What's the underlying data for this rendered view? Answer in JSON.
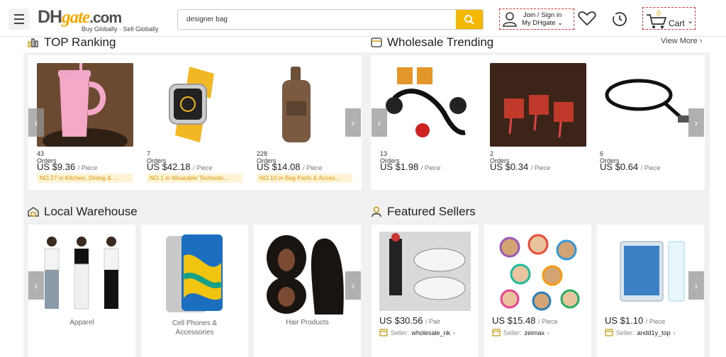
{
  "header": {
    "logo_dh": "DH",
    "logo_gate": "gate",
    "logo_com": ".com",
    "tagline": "Buy Globally · Sell Globally",
    "search_value": "designer bag",
    "account_line1": "Join / Sign in",
    "account_line2": "My DHgate",
    "cart_count": "0",
    "cart_label": "Cart"
  },
  "top_ranking": {
    "title": "TOP Ranking",
    "items": [
      {
        "orders": "43 Orders",
        "price": "US $9.36",
        "unit": "/ Piece",
        "rank": "NO.27 in Kitchen, Dining & ..."
      },
      {
        "orders": "7 Orders",
        "price": "US $42.18",
        "unit": "/ Piece",
        "rank": "NO.1 in Wearable Technolo..."
      },
      {
        "orders": "228 Orders",
        "price": "US $14.08",
        "unit": "/ Piece",
        "rank": "NO.10 in Bag Parts & Acces..."
      }
    ]
  },
  "wholesale_trending": {
    "title": "Wholesale Trending",
    "view_more": "View More",
    "items": [
      {
        "orders": "13 Orders",
        "price": "US $1.98",
        "unit": "/ Piece"
      },
      {
        "orders": "2 Orders",
        "price": "US $0.34",
        "unit": "/ Piece"
      },
      {
        "orders": "6 Orders",
        "price": "US $0.64",
        "unit": "/ Piece"
      }
    ]
  },
  "local_warehouse": {
    "title": "Local Warehouse",
    "categories": [
      {
        "label": "Apparel"
      },
      {
        "label": "Cell Phones &\nAccessories"
      },
      {
        "label": "Hair Products"
      }
    ]
  },
  "featured_sellers": {
    "title": "Featured Sellers",
    "items": [
      {
        "price": "US $30.56",
        "unit": "/ Pair",
        "seller_prefix": "Seller:",
        "seller": "wholesale_nk"
      },
      {
        "price": "US $15.48",
        "unit": "/ Piece",
        "seller_prefix": "Seller:",
        "seller": "zeimax"
      },
      {
        "price": "US $1.10",
        "unit": "/ Piece",
        "seller_prefix": "Seller:",
        "seller": "andd1y_top"
      }
    ]
  },
  "icons": [
    "menu-icon",
    "search-icon",
    "user-icon",
    "heart-icon",
    "history-icon",
    "cart-icon",
    "ranking-icon",
    "trending-icon",
    "warehouse-icon",
    "seller-icon",
    "chevron-left-icon",
    "chevron-right-icon",
    "store-icon"
  ],
  "colors": {
    "brand_yellow": "#f5b800",
    "rank_tag_bg": "#fff3d6",
    "rank_tag_text": "#e19500",
    "dashed_border": "#dd3333"
  }
}
